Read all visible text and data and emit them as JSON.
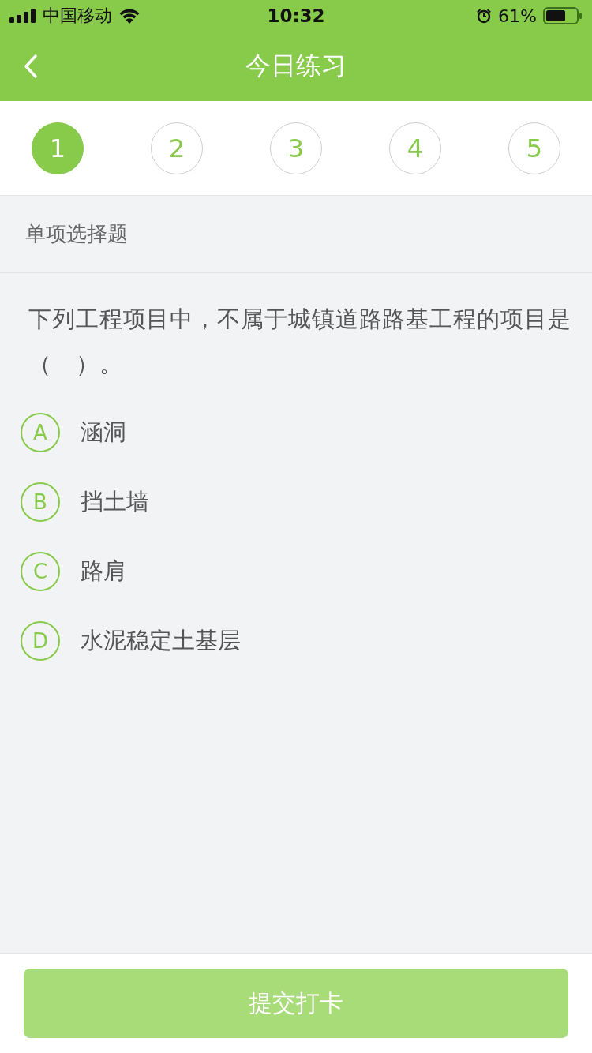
{
  "status_bar": {
    "carrier": "中国移动",
    "time": "10:32",
    "battery": "61%"
  },
  "nav": {
    "title": "今日练习"
  },
  "steps": [
    {
      "label": "1",
      "selected": true
    },
    {
      "label": "2",
      "selected": false
    },
    {
      "label": "3",
      "selected": false
    },
    {
      "label": "4",
      "selected": false
    },
    {
      "label": "5",
      "selected": false
    }
  ],
  "section": {
    "title": "单项选择题"
  },
  "question": {
    "text": "下列工程项目中，不属于城镇道路路基工程的项目是（　）。"
  },
  "options": [
    {
      "letter": "A",
      "text": "涵洞",
      "selected": false
    },
    {
      "letter": "B",
      "text": "挡土墙",
      "selected": false
    },
    {
      "letter": "C",
      "text": "路肩",
      "selected": false
    },
    {
      "letter": "D",
      "text": "水泥稳定土基层",
      "selected": false
    }
  ],
  "submit": {
    "label": "提交打卡",
    "disabled": true
  }
}
